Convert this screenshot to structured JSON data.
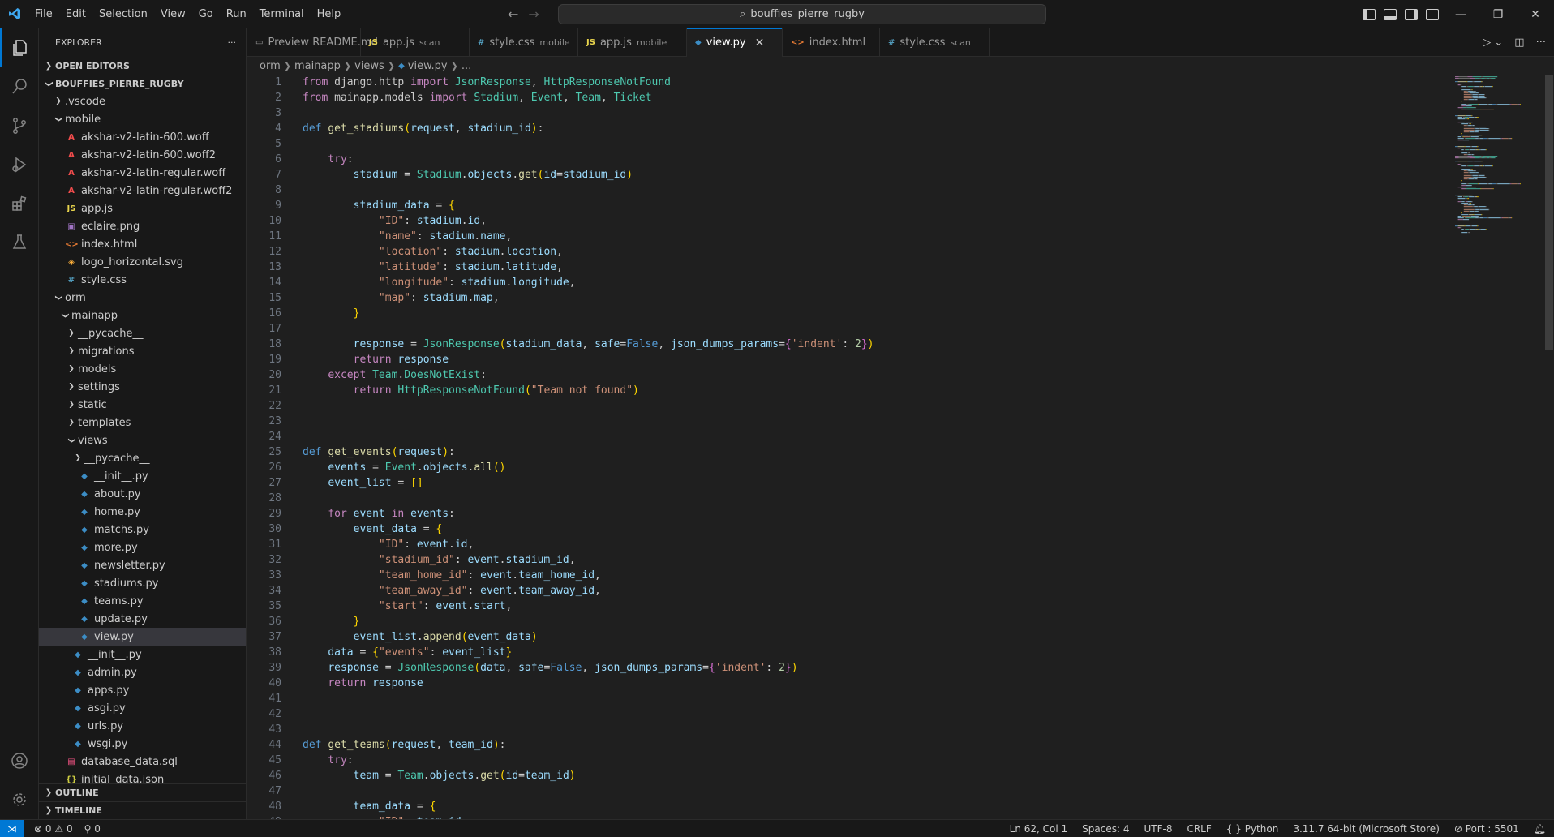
{
  "titlebar": {
    "menu": [
      "File",
      "Edit",
      "Selection",
      "View",
      "Go",
      "Run",
      "Terminal",
      "Help"
    ],
    "search_text": "bouffies_pierre_rugby",
    "window_controls": [
      "—",
      "❐",
      "✕"
    ]
  },
  "sidebar": {
    "title": "EXPLORER",
    "more": "···",
    "open_editors": "OPEN EDITORS",
    "project": "BOUFFIES_PIERRE_RUGBY",
    "outline": "OUTLINE",
    "timeline": "TIMELINE",
    "tree": [
      {
        "label": ".vscode",
        "depth": 1,
        "kind": "folder-closed"
      },
      {
        "label": "mobile",
        "depth": 1,
        "kind": "folder-open"
      },
      {
        "label": "akshar-v2-latin-600.woff",
        "depth": 2,
        "kind": "font",
        "icon": "A",
        "color": "#f14c4c"
      },
      {
        "label": "akshar-v2-latin-600.woff2",
        "depth": 2,
        "kind": "font",
        "icon": "A",
        "color": "#f14c4c"
      },
      {
        "label": "akshar-v2-latin-regular.woff",
        "depth": 2,
        "kind": "font",
        "icon": "A",
        "color": "#f14c4c"
      },
      {
        "label": "akshar-v2-latin-regular.woff2",
        "depth": 2,
        "kind": "font",
        "icon": "A",
        "color": "#f14c4c"
      },
      {
        "label": "app.js",
        "depth": 2,
        "kind": "js",
        "icon": "JS",
        "color": "#e8d44d"
      },
      {
        "label": "eclaire.png",
        "depth": 2,
        "kind": "image",
        "icon": "▣",
        "color": "#a074c4"
      },
      {
        "label": "index.html",
        "depth": 2,
        "kind": "html",
        "icon": "<>",
        "color": "#e37933"
      },
      {
        "label": "logo_horizontal.svg",
        "depth": 2,
        "kind": "svg",
        "icon": "◈",
        "color": "#ffb13b"
      },
      {
        "label": "style.css",
        "depth": 2,
        "kind": "css",
        "icon": "#",
        "color": "#519aba"
      },
      {
        "label": "orm",
        "depth": 1,
        "kind": "folder-open"
      },
      {
        "label": "mainapp",
        "depth": 2,
        "kind": "folder-open"
      },
      {
        "label": "__pycache__",
        "depth": 3,
        "kind": "folder-closed"
      },
      {
        "label": "migrations",
        "depth": 3,
        "kind": "folder-closed"
      },
      {
        "label": "models",
        "depth": 3,
        "kind": "folder-closed"
      },
      {
        "label": "settings",
        "depth": 3,
        "kind": "folder-closed"
      },
      {
        "label": "static",
        "depth": 3,
        "kind": "folder-closed"
      },
      {
        "label": "templates",
        "depth": 3,
        "kind": "folder-closed"
      },
      {
        "label": "views",
        "depth": 3,
        "kind": "folder-open"
      },
      {
        "label": "__pycache__",
        "depth": 4,
        "kind": "folder-closed"
      },
      {
        "label": "__init__.py",
        "depth": 4,
        "kind": "py",
        "icon": "◆",
        "color": "#3c8dc5"
      },
      {
        "label": "about.py",
        "depth": 4,
        "kind": "py",
        "icon": "◆",
        "color": "#3c8dc5"
      },
      {
        "label": "home.py",
        "depth": 4,
        "kind": "py",
        "icon": "◆",
        "color": "#3c8dc5"
      },
      {
        "label": "matchs.py",
        "depth": 4,
        "kind": "py",
        "icon": "◆",
        "color": "#3c8dc5"
      },
      {
        "label": "more.py",
        "depth": 4,
        "kind": "py",
        "icon": "◆",
        "color": "#3c8dc5"
      },
      {
        "label": "newsletter.py",
        "depth": 4,
        "kind": "py",
        "icon": "◆",
        "color": "#3c8dc5"
      },
      {
        "label": "stadiums.py",
        "depth": 4,
        "kind": "py",
        "icon": "◆",
        "color": "#3c8dc5"
      },
      {
        "label": "teams.py",
        "depth": 4,
        "kind": "py",
        "icon": "◆",
        "color": "#3c8dc5"
      },
      {
        "label": "update.py",
        "depth": 4,
        "kind": "py",
        "icon": "◆",
        "color": "#3c8dc5"
      },
      {
        "label": "view.py",
        "depth": 4,
        "kind": "py",
        "icon": "◆",
        "color": "#3c8dc5",
        "selected": true
      },
      {
        "label": "__init__.py",
        "depth": 3,
        "kind": "py",
        "icon": "◆",
        "color": "#3c8dc5"
      },
      {
        "label": "admin.py",
        "depth": 3,
        "kind": "py",
        "icon": "◆",
        "color": "#3c8dc5"
      },
      {
        "label": "apps.py",
        "depth": 3,
        "kind": "py",
        "icon": "◆",
        "color": "#3c8dc5"
      },
      {
        "label": "asgi.py",
        "depth": 3,
        "kind": "py",
        "icon": "◆",
        "color": "#3c8dc5"
      },
      {
        "label": "urls.py",
        "depth": 3,
        "kind": "py",
        "icon": "◆",
        "color": "#3c8dc5"
      },
      {
        "label": "wsgi.py",
        "depth": 3,
        "kind": "py",
        "icon": "◆",
        "color": "#3c8dc5"
      },
      {
        "label": "database_data.sql",
        "depth": 2,
        "kind": "sql",
        "icon": "▤",
        "color": "#f55385"
      },
      {
        "label": "initial_data.json",
        "depth": 2,
        "kind": "json",
        "icon": "{}",
        "color": "#cbcb41"
      }
    ]
  },
  "tabs": [
    {
      "label": "Preview README.md",
      "desc": "",
      "icon": "▭",
      "color": "#9d9d9d"
    },
    {
      "label": "app.js",
      "desc": "scan",
      "icon": "JS",
      "color": "#e8d44d"
    },
    {
      "label": "style.css",
      "desc": "mobile",
      "icon": "#",
      "color": "#519aba"
    },
    {
      "label": "app.js",
      "desc": "mobile",
      "icon": "JS",
      "color": "#e8d44d"
    },
    {
      "label": "view.py",
      "desc": "",
      "icon": "◆",
      "color": "#3c8dc5",
      "active": true
    },
    {
      "label": "index.html",
      "desc": "",
      "icon": "<>",
      "color": "#e37933"
    },
    {
      "label": "style.css",
      "desc": "scan",
      "icon": "#",
      "color": "#519aba"
    }
  ],
  "breadcrumb": [
    "orm",
    "mainapp",
    "views",
    "view.py",
    "..."
  ],
  "code": [
    [
      [
        "k",
        "from "
      ],
      [
        "p",
        "django.http "
      ],
      [
        "k",
        "import "
      ],
      [
        "c",
        "JsonResponse"
      ],
      [
        "p",
        ", "
      ],
      [
        "c",
        "HttpResponseNotFound"
      ]
    ],
    [
      [
        "k",
        "from "
      ],
      [
        "p",
        "mainapp.models "
      ],
      [
        "k",
        "import "
      ],
      [
        "c",
        "Stadium"
      ],
      [
        "p",
        ", "
      ],
      [
        "c",
        "Event"
      ],
      [
        "p",
        ", "
      ],
      [
        "c",
        "Team"
      ],
      [
        "p",
        ", "
      ],
      [
        "c",
        "Ticket"
      ]
    ],
    [],
    [
      [
        "d",
        "def "
      ],
      [
        "f",
        "get_stadiums"
      ],
      [
        "b1",
        "("
      ],
      [
        "v",
        "request"
      ],
      [
        "p",
        ", "
      ],
      [
        "v",
        "stadium_id"
      ],
      [
        "b1",
        ")"
      ],
      [
        "p",
        ":"
      ]
    ],
    [],
    [
      [
        "p",
        "    "
      ],
      [
        "k",
        "try"
      ],
      [
        "p",
        ":"
      ]
    ],
    [
      [
        "p",
        "        "
      ],
      [
        "v",
        "stadium"
      ],
      [
        "p",
        " = "
      ],
      [
        "c",
        "Stadium"
      ],
      [
        "p",
        "."
      ],
      [
        "v",
        "objects"
      ],
      [
        "p",
        "."
      ],
      [
        "f",
        "get"
      ],
      [
        "b1",
        "("
      ],
      [
        "v",
        "id"
      ],
      [
        "p",
        "="
      ],
      [
        "v",
        "stadium_id"
      ],
      [
        "b1",
        ")"
      ]
    ],
    [],
    [
      [
        "p",
        "        "
      ],
      [
        "v",
        "stadium_data"
      ],
      [
        "p",
        " = "
      ],
      [
        "b1",
        "{"
      ]
    ],
    [
      [
        "p",
        "            "
      ],
      [
        "s",
        "\"ID\""
      ],
      [
        "p",
        ": "
      ],
      [
        "v",
        "stadium"
      ],
      [
        "p",
        "."
      ],
      [
        "v",
        "id"
      ],
      [
        "p",
        ","
      ]
    ],
    [
      [
        "p",
        "            "
      ],
      [
        "s",
        "\"name\""
      ],
      [
        "p",
        ": "
      ],
      [
        "v",
        "stadium"
      ],
      [
        "p",
        "."
      ],
      [
        "v",
        "name"
      ],
      [
        "p",
        ","
      ]
    ],
    [
      [
        "p",
        "            "
      ],
      [
        "s",
        "\"location\""
      ],
      [
        "p",
        ": "
      ],
      [
        "v",
        "stadium"
      ],
      [
        "p",
        "."
      ],
      [
        "v",
        "location"
      ],
      [
        "p",
        ","
      ]
    ],
    [
      [
        "p",
        "            "
      ],
      [
        "s",
        "\"latitude\""
      ],
      [
        "p",
        ": "
      ],
      [
        "v",
        "stadium"
      ],
      [
        "p",
        "."
      ],
      [
        "v",
        "latitude"
      ],
      [
        "p",
        ","
      ]
    ],
    [
      [
        "p",
        "            "
      ],
      [
        "s",
        "\"longitude\""
      ],
      [
        "p",
        ": "
      ],
      [
        "v",
        "stadium"
      ],
      [
        "p",
        "."
      ],
      [
        "v",
        "longitude"
      ],
      [
        "p",
        ","
      ]
    ],
    [
      [
        "p",
        "            "
      ],
      [
        "s",
        "\"map\""
      ],
      [
        "p",
        ": "
      ],
      [
        "v",
        "stadium"
      ],
      [
        "p",
        "."
      ],
      [
        "v",
        "map"
      ],
      [
        "p",
        ","
      ]
    ],
    [
      [
        "p",
        "        "
      ],
      [
        "b1",
        "}"
      ]
    ],
    [],
    [
      [
        "p",
        "        "
      ],
      [
        "v",
        "response"
      ],
      [
        "p",
        " = "
      ],
      [
        "c",
        "JsonResponse"
      ],
      [
        "b1",
        "("
      ],
      [
        "v",
        "stadium_data"
      ],
      [
        "p",
        ", "
      ],
      [
        "v",
        "safe"
      ],
      [
        "p",
        "="
      ],
      [
        "d",
        "False"
      ],
      [
        "p",
        ", "
      ],
      [
        "v",
        "json_dumps_params"
      ],
      [
        "p",
        "="
      ],
      [
        "b2",
        "{"
      ],
      [
        "s",
        "'indent'"
      ],
      [
        "p",
        ": "
      ],
      [
        "n",
        "2"
      ],
      [
        "b2",
        "}"
      ],
      [
        "b1",
        ")"
      ]
    ],
    [
      [
        "p",
        "        "
      ],
      [
        "k",
        "return "
      ],
      [
        "v",
        "response"
      ]
    ],
    [
      [
        "p",
        "    "
      ],
      [
        "k",
        "except "
      ],
      [
        "c",
        "Team"
      ],
      [
        "p",
        "."
      ],
      [
        "c",
        "DoesNotExist"
      ],
      [
        "p",
        ":"
      ]
    ],
    [
      [
        "p",
        "        "
      ],
      [
        "k",
        "return "
      ],
      [
        "c",
        "HttpResponseNotFound"
      ],
      [
        "b1",
        "("
      ],
      [
        "s",
        "\"Team not found\""
      ],
      [
        "b1",
        ")"
      ]
    ],
    [],
    [],
    [],
    [
      [
        "d",
        "def "
      ],
      [
        "f",
        "get_events"
      ],
      [
        "b1",
        "("
      ],
      [
        "v",
        "request"
      ],
      [
        "b1",
        ")"
      ],
      [
        "p",
        ":"
      ]
    ],
    [
      [
        "p",
        "    "
      ],
      [
        "v",
        "events"
      ],
      [
        "p",
        " = "
      ],
      [
        "c",
        "Event"
      ],
      [
        "p",
        "."
      ],
      [
        "v",
        "objects"
      ],
      [
        "p",
        "."
      ],
      [
        "f",
        "all"
      ],
      [
        "b1",
        "()"
      ]
    ],
    [
      [
        "p",
        "    "
      ],
      [
        "v",
        "event_list"
      ],
      [
        "p",
        " = "
      ],
      [
        "b1",
        "[]"
      ]
    ],
    [],
    [
      [
        "p",
        "    "
      ],
      [
        "k",
        "for "
      ],
      [
        "v",
        "event"
      ],
      [
        "k",
        " in "
      ],
      [
        "v",
        "events"
      ],
      [
        "p",
        ":"
      ]
    ],
    [
      [
        "p",
        "        "
      ],
      [
        "v",
        "event_data"
      ],
      [
        "p",
        " = "
      ],
      [
        "b1",
        "{"
      ]
    ],
    [
      [
        "p",
        "            "
      ],
      [
        "s",
        "\"ID\""
      ],
      [
        "p",
        ": "
      ],
      [
        "v",
        "event"
      ],
      [
        "p",
        "."
      ],
      [
        "v",
        "id"
      ],
      [
        "p",
        ","
      ]
    ],
    [
      [
        "p",
        "            "
      ],
      [
        "s",
        "\"stadium_id\""
      ],
      [
        "p",
        ": "
      ],
      [
        "v",
        "event"
      ],
      [
        "p",
        "."
      ],
      [
        "v",
        "stadium_id"
      ],
      [
        "p",
        ","
      ]
    ],
    [
      [
        "p",
        "            "
      ],
      [
        "s",
        "\"team_home_id\""
      ],
      [
        "p",
        ": "
      ],
      [
        "v",
        "event"
      ],
      [
        "p",
        "."
      ],
      [
        "v",
        "team_home_id"
      ],
      [
        "p",
        ","
      ]
    ],
    [
      [
        "p",
        "            "
      ],
      [
        "s",
        "\"team_away_id\""
      ],
      [
        "p",
        ": "
      ],
      [
        "v",
        "event"
      ],
      [
        "p",
        "."
      ],
      [
        "v",
        "team_away_id"
      ],
      [
        "p",
        ","
      ]
    ],
    [
      [
        "p",
        "            "
      ],
      [
        "s",
        "\"start\""
      ],
      [
        "p",
        ": "
      ],
      [
        "v",
        "event"
      ],
      [
        "p",
        "."
      ],
      [
        "v",
        "start"
      ],
      [
        "p",
        ","
      ]
    ],
    [
      [
        "p",
        "        "
      ],
      [
        "b1",
        "}"
      ]
    ],
    [
      [
        "p",
        "        "
      ],
      [
        "v",
        "event_list"
      ],
      [
        "p",
        "."
      ],
      [
        "f",
        "append"
      ],
      [
        "b1",
        "("
      ],
      [
        "v",
        "event_data"
      ],
      [
        "b1",
        ")"
      ]
    ],
    [
      [
        "p",
        "    "
      ],
      [
        "v",
        "data"
      ],
      [
        "p",
        " = "
      ],
      [
        "b1",
        "{"
      ],
      [
        "s",
        "\"events\""
      ],
      [
        "p",
        ": "
      ],
      [
        "v",
        "event_list"
      ],
      [
        "b1",
        "}"
      ]
    ],
    [
      [
        "p",
        "    "
      ],
      [
        "v",
        "response"
      ],
      [
        "p",
        " = "
      ],
      [
        "c",
        "JsonResponse"
      ],
      [
        "b1",
        "("
      ],
      [
        "v",
        "data"
      ],
      [
        "p",
        ", "
      ],
      [
        "v",
        "safe"
      ],
      [
        "p",
        "="
      ],
      [
        "d",
        "False"
      ],
      [
        "p",
        ", "
      ],
      [
        "v",
        "json_dumps_params"
      ],
      [
        "p",
        "="
      ],
      [
        "b2",
        "{"
      ],
      [
        "s",
        "'indent'"
      ],
      [
        "p",
        ": "
      ],
      [
        "n",
        "2"
      ],
      [
        "b2",
        "}"
      ],
      [
        "b1",
        ")"
      ]
    ],
    [
      [
        "p",
        "    "
      ],
      [
        "k",
        "return "
      ],
      [
        "v",
        "response"
      ]
    ],
    [],
    [],
    [],
    [
      [
        "d",
        "def "
      ],
      [
        "f",
        "get_teams"
      ],
      [
        "b1",
        "("
      ],
      [
        "v",
        "request"
      ],
      [
        "p",
        ", "
      ],
      [
        "v",
        "team_id"
      ],
      [
        "b1",
        ")"
      ],
      [
        "p",
        ":"
      ]
    ],
    [
      [
        "p",
        "    "
      ],
      [
        "k",
        "try"
      ],
      [
        "p",
        ":"
      ]
    ],
    [
      [
        "p",
        "        "
      ],
      [
        "v",
        "team"
      ],
      [
        "p",
        " = "
      ],
      [
        "c",
        "Team"
      ],
      [
        "p",
        "."
      ],
      [
        "v",
        "objects"
      ],
      [
        "p",
        "."
      ],
      [
        "f",
        "get"
      ],
      [
        "b1",
        "("
      ],
      [
        "v",
        "id"
      ],
      [
        "p",
        "="
      ],
      [
        "v",
        "team_id"
      ],
      [
        "b1",
        ")"
      ]
    ],
    [],
    [
      [
        "p",
        "        "
      ],
      [
        "v",
        "team_data"
      ],
      [
        "p",
        " = "
      ],
      [
        "b1",
        "{"
      ]
    ],
    [
      [
        "p",
        "            "
      ],
      [
        "s",
        "\"ID\""
      ],
      [
        "p",
        ": "
      ],
      [
        "v",
        "team"
      ],
      [
        "p",
        "."
      ],
      [
        "v",
        "id"
      ],
      [
        "p",
        ","
      ]
    ]
  ],
  "statusbar": {
    "errors": "0",
    "warnings": "0",
    "ports": "0",
    "position": "Ln 62, Col 1",
    "spaces": "Spaces: 4",
    "encoding": "UTF-8",
    "eol": "CRLF",
    "language": "Python",
    "interpreter": "3.11.7 64-bit (Microsoft Store)",
    "port": "Port : 5501"
  }
}
